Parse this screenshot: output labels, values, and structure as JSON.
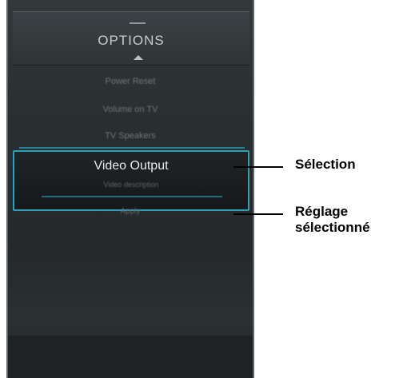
{
  "options_panel": {
    "title": "OPTIONS",
    "menu_items": [
      "Power Reset",
      "Volume on TV",
      "TV Speakers"
    ],
    "selected_item": {
      "label": "Video Output",
      "sub_label": "Video description",
      "setting_value": "Apply"
    },
    "accent_color": "#2ea0b8"
  },
  "callouts": {
    "selection": "Sélection",
    "setting_line1": "Réglage",
    "setting_line2": "sélectionné"
  }
}
